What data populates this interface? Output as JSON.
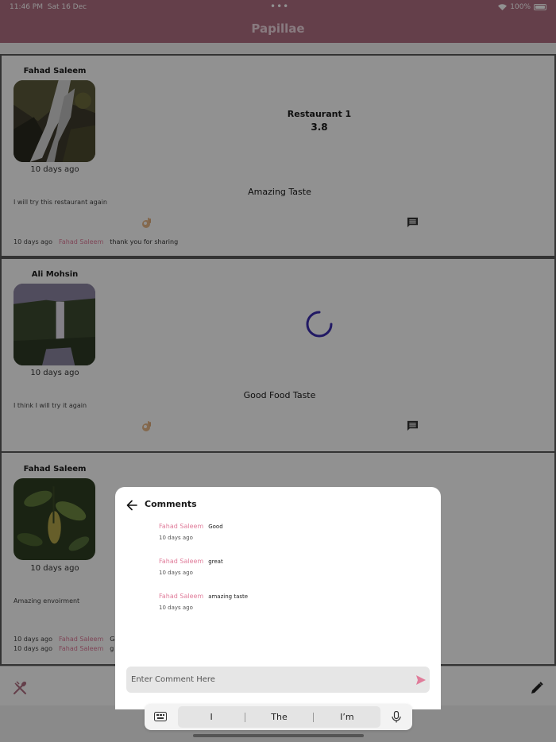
{
  "status_bar": {
    "time": "11:46 PM",
    "date": "Sat 16 Dec",
    "battery": "100%"
  },
  "app_bar": {
    "title": "Papillae"
  },
  "posts": [
    {
      "author": "Fahad Saleem",
      "date": "10 days ago",
      "restaurant": "Restaurant 1",
      "rating": "3.8",
      "review_title": "Amazing Taste",
      "review_text": "I will try this restaurant again",
      "comments": [
        {
          "date": "10 days ago",
          "user": "Fahad Saleem",
          "text": "thank you for sharing"
        }
      ]
    },
    {
      "author": "Ali Mohsin",
      "date": "10 days ago",
      "review_title": "Good Food Taste",
      "review_text": "I think I will try it again"
    },
    {
      "author": "Fahad Saleem",
      "date": "10 days ago",
      "review_text": "Amazing envoirment",
      "comments": [
        {
          "date": "10 days ago",
          "user": "Fahad Saleem",
          "text": "G"
        },
        {
          "date": "10 days ago",
          "user": "Fahad Saleem",
          "text": "g"
        }
      ]
    }
  ],
  "comments_sheet": {
    "title": "Comments",
    "items": [
      {
        "user": "Fahad Saleem",
        "text": "Good",
        "date": "10 days ago"
      },
      {
        "user": "Fahad Saleem",
        "text": "great",
        "date": "10 days ago"
      },
      {
        "user": "Fahad Saleem",
        "text": "amazing taste",
        "date": "10 days ago"
      }
    ],
    "input_placeholder": "Enter Comment Here"
  },
  "keyboard": {
    "suggestions": [
      "I",
      "The",
      "I’m"
    ]
  },
  "colors": {
    "brand": "#b06f83",
    "accent_pink": "#e07c9a",
    "spinner": "#3b2db0"
  }
}
